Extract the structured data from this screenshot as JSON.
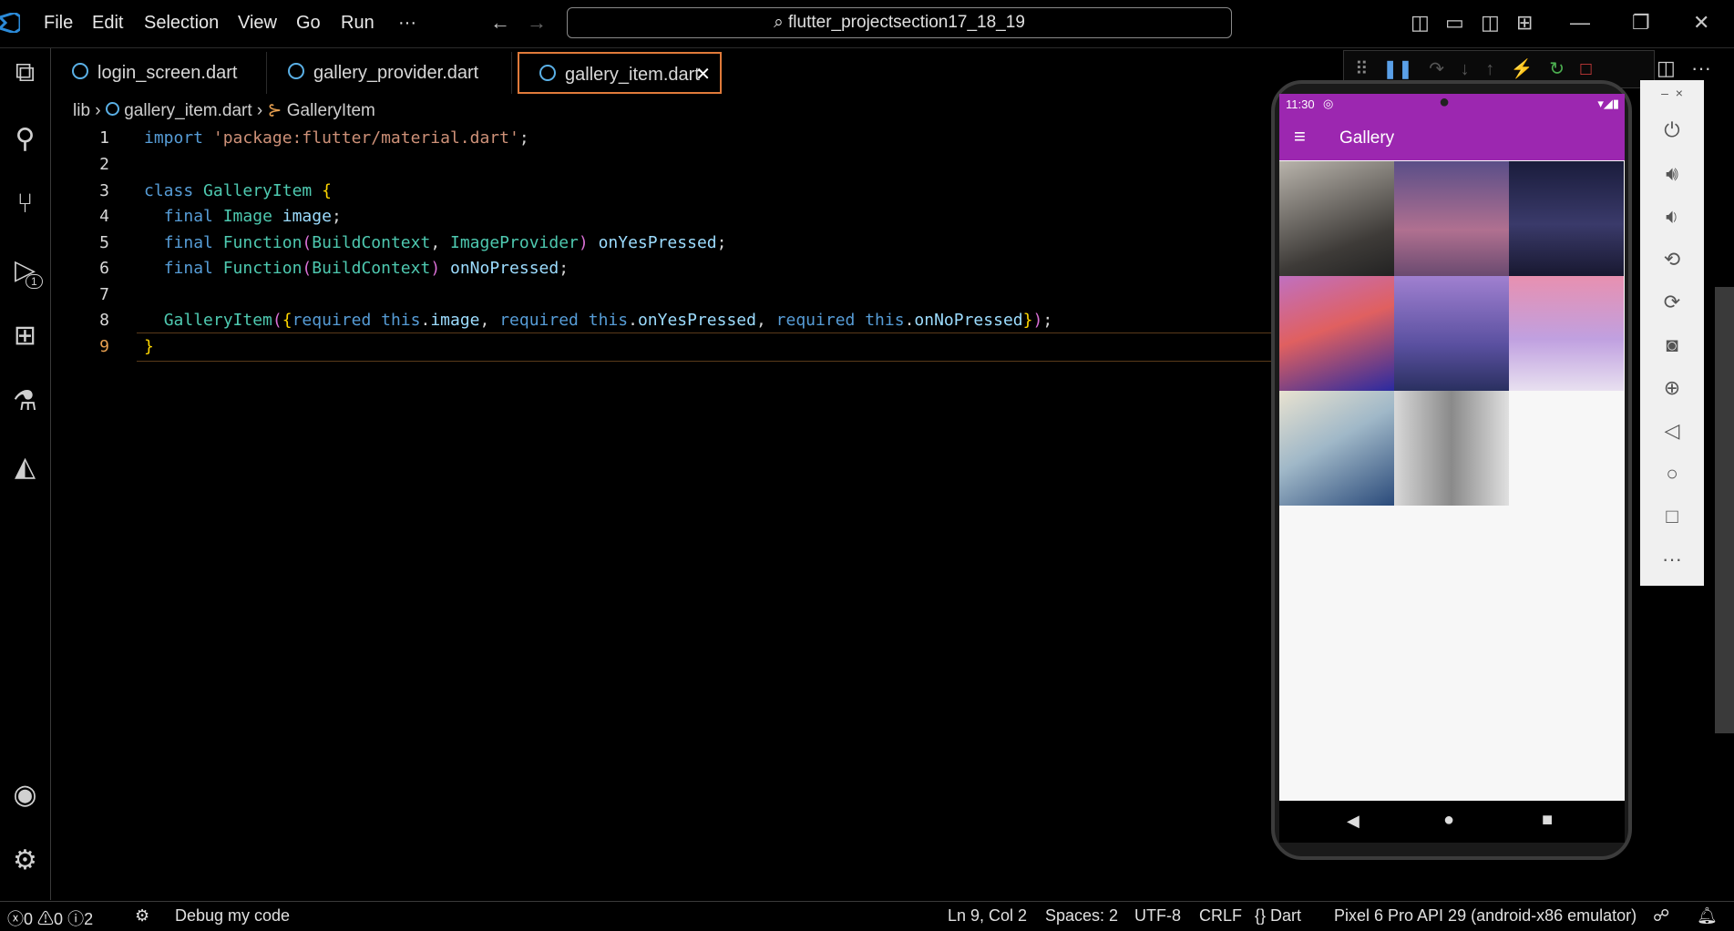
{
  "titlebar": {
    "menus": [
      "File",
      "Edit",
      "Selection",
      "View",
      "Go",
      "Run",
      "···"
    ],
    "search": "flutter_projectsection17_18_19"
  },
  "tabs": [
    {
      "label": "login_screen.dart"
    },
    {
      "label": "gallery_provider.dart"
    },
    {
      "label": "gallery_item.dart",
      "active": true
    }
  ],
  "breadcrumb": {
    "folder": "lib",
    "file": "gallery_item.dart",
    "symbol": "GalleryItem"
  },
  "editor": {
    "line_numbers": [
      "1",
      "2",
      "3",
      "4",
      "5",
      "6",
      "7",
      "8",
      "9"
    ],
    "current_line": "9",
    "lines": [
      "import 'package:flutter/material.dart';",
      "",
      "class GalleryItem {",
      "  final Image image;",
      "  final Function(BuildContext, ImageProvider) onYesPressed;",
      "  final Function(BuildContext) onNoPressed;",
      "",
      "  GalleryItem({required this.image, required this.onYesPressed, required this.onNoPressed});",
      "}"
    ]
  },
  "activity_badge": "1",
  "status": {
    "errors": "0",
    "warnings": "0",
    "infos": "2",
    "debug": "Debug my code",
    "position": "Ln 9, Col 2",
    "spaces": "Spaces: 2",
    "encoding": "UTF-8",
    "eol": "CRLF",
    "language": "Dart",
    "device": "Pixel 6 Pro API 29 (android-x86 emulator)"
  },
  "phone": {
    "time": "11:30",
    "app_title": "Gallery"
  },
  "colors": {
    "accent": "#9c27b0",
    "active_tab_border": "#e07a3a",
    "bg": "#000000"
  }
}
